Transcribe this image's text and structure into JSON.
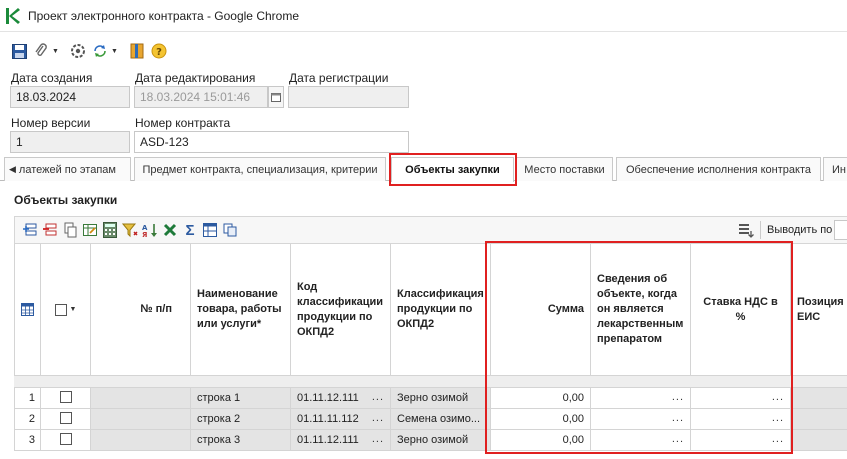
{
  "window": {
    "title": "Проект электронного контракта - Google Chrome"
  },
  "form": {
    "created": {
      "label": "Дата создания",
      "value": "18.03.2024"
    },
    "edited": {
      "label": "Дата редактирования",
      "value": "18.03.2024 15:01:46"
    },
    "registered": {
      "label": "Дата регистрации",
      "value": ""
    },
    "version": {
      "label": "Номер версии",
      "value": "1"
    },
    "contract_no": {
      "label": "Номер контракта",
      "value": "ASD-123"
    }
  },
  "tabs": [
    {
      "label": "латежей по этапам"
    },
    {
      "label": "Предмет контракта, специализация, критерии"
    },
    {
      "label": "Объекты закупки"
    },
    {
      "label": "Место поставки"
    },
    {
      "label": "Обеспечение исполнения контракта"
    },
    {
      "label": "Ин"
    }
  ],
  "section": {
    "title": "Объекты закупки"
  },
  "grid_toolbar": {
    "output_label": "Выводить по"
  },
  "grid": {
    "headers": {
      "num": "№ п/п",
      "name": "Наименование товара, работы или услуги*",
      "code": "Код классификации продукции по ОКПД2",
      "class": "Классификация продукции по ОКПД2",
      "sum": "Сумма",
      "medinfo": "Сведения об объекте, когда он является лекарственным препаратом",
      "vat": "Ставка НДС в %",
      "pos": "Позиция ЕИС"
    },
    "dots": "...",
    "rows": [
      {
        "n": "1",
        "name": "строка 1",
        "code": "01.11.12.111",
        "class": "Зерно озимой",
        "sum": "0,00"
      },
      {
        "n": "2",
        "name": "строка 2",
        "code": "01.11.11.112",
        "class": "Семена озимо...",
        "sum": "0,00"
      },
      {
        "n": "3",
        "name": "строка 3",
        "code": "01.11.12.111",
        "class": "Зерно озимой",
        "sum": "0,00"
      }
    ]
  },
  "colors": {
    "highlight": "#e02020",
    "app_icon": "#1b8a3a"
  }
}
